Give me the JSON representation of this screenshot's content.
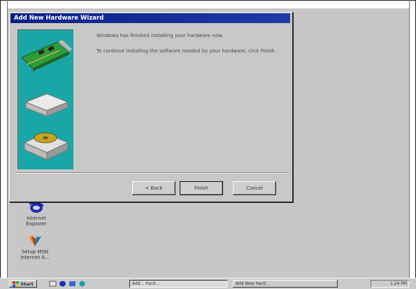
{
  "wizard": {
    "title": "Add New Hardware Wizard",
    "message_1": "Windows has finished installing your hardware now.",
    "message_2": "To continue installing the software needed by your hardware, click Finish.",
    "buttons": {
      "back": "< Back",
      "finish": "Finish",
      "cancel": "Cancel"
    },
    "art_icons": [
      "expansion-card-icon",
      "drive-icon",
      "disk-drive-icon"
    ],
    "art_color": "#1aa6a6"
  },
  "desktop": {
    "background_color": "#c7c7c7",
    "icons": [
      {
        "label": "Internet\nExplorer",
        "icon": "internet-explorer-icon"
      },
      {
        "label": "Setup MSN\nInternet A...",
        "icon": "msn-butterfly-icon"
      }
    ]
  },
  "taskbar": {
    "start_label": "Start",
    "task_1": "Add... Hard...",
    "task_2": "Add New Hard...",
    "clock": "1:24 PM"
  },
  "colors": {
    "titlebar": "#0b1f86",
    "window_face": "#c8c8c8"
  }
}
